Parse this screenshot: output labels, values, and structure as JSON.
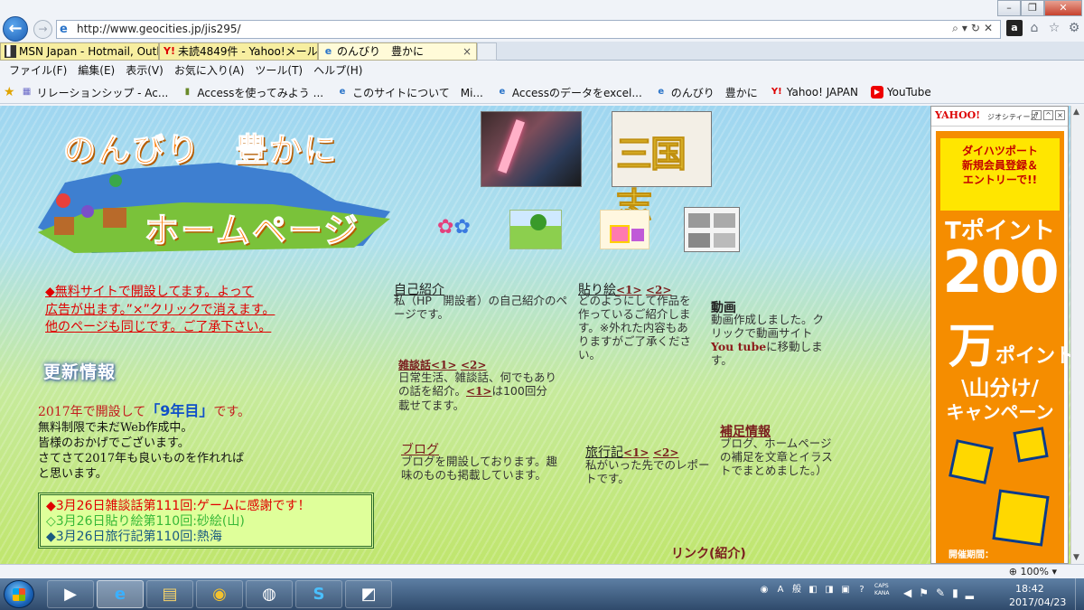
{
  "browser": {
    "url": "http://www.geocities.jp/jis295/",
    "tabs": [
      {
        "label": "MSN Japan - Hotmail, Outl...",
        "icon": "msn-icon"
      },
      {
        "label": "未読4849件 - Yahoo!メール",
        "icon": "yahoo-icon",
        "badge": "Y!"
      },
      {
        "label": "のんびり　豊かに",
        "icon": "ie-page-icon",
        "close": "×"
      }
    ],
    "menu": [
      "ファイル(F)",
      "編集(E)",
      "表示(V)",
      "お気に入り(A)",
      "ツール(T)",
      "ヘルプ(H)"
    ],
    "favorites": [
      {
        "label": "リレーションシップ - Ac...",
        "icon": "grid-icon"
      },
      {
        "label": "Accessを使ってみよう ...",
        "icon": "book-icon"
      },
      {
        "label": "このサイトについて　Mi...",
        "icon": "ie-page-icon"
      },
      {
        "label": "Accessのデータをexcel...",
        "icon": "ie-page-icon"
      },
      {
        "label": "のんびり　豊かに",
        "icon": "ie-page-icon"
      },
      {
        "label": "Yahoo! JAPAN",
        "icon": "yahoo-icon",
        "badge": "Y!"
      },
      {
        "label": "YouTube",
        "icon": "youtube-icon"
      }
    ],
    "zoom": "100%"
  },
  "page": {
    "logo": {
      "line1": "のんびり　豊かに",
      "line2": "ホームページ"
    },
    "photo_text": "三国志",
    "notices": [
      "◆無料サイトで開設してます。よって",
      "広告が出ます。”×”クリックで消えます。",
      "他のページも同じです。ご了承下さい。"
    ],
    "update_title": "更新情報",
    "open": {
      "pre": "2017年で開設して",
      "big": "「9年目」",
      "post": "です。"
    },
    "body_lines": [
      "無料制限で未だWeb作成中。",
      "皆様のおかげでございます。",
      "さてさて2017年も良いものを作れれば",
      "と思います。"
    ],
    "news": [
      "◆3月26日雑談話第111回:ゲームに感謝です！",
      "◇3月26日貼り絵第110回:砂絵(山)",
      "◆3月26日旅行記第110回:熱海"
    ],
    "sections": {
      "jiko": {
        "title": "自己紹介",
        "body": "私（HP　開設者）の自己紹介のページです。"
      },
      "zatsu": {
        "title": "雑談話",
        "l1": "<1>",
        "l2": "<2>",
        "body_pre": "日常生活、雑談話、何でもありの話を紹介。",
        "inline": "<1>",
        "body_post": "は100回分載せてます。"
      },
      "blog": {
        "title": "ブログ",
        "body": "ブログを開設しております。趣味のものも掲載しています。"
      },
      "hari": {
        "title": "貼り絵",
        "l1": "<1>",
        "l2": "<2>",
        "body": "どのようにして作品を作っているご紹介します。※外れた内容もありますがご了承ください。"
      },
      "ryoko": {
        "title": "旅行記",
        "l1": "<1>",
        "l2": "<2>",
        "body": "私がいった先でのレポートです。"
      },
      "douga": {
        "title": "動画",
        "body_pre": "動画作成しました。クリックで動画サイト",
        "link": "You tube",
        "body_post": "に移動します。"
      },
      "hosoku": {
        "title": "補足情報",
        "body": "ブログ、ホームページの補足を文章とイラストでまとめました。）"
      },
      "link": {
        "title": "リンク(紹介)"
      }
    }
  },
  "ad": {
    "yahoo": "YAHOO!",
    "geo": "ジオシティーズ",
    "ctrls": [
      "?",
      "^",
      "×"
    ],
    "yellow": [
      "ダイハツポート",
      "新規会員登録＆",
      "エントリーで!!"
    ],
    "t1": "Tポイント",
    "t2": "200",
    "t3_big": "万",
    "t3_small": "ポイント",
    "t4": "\\山分け/",
    "t5": "キャンペーン",
    "period": "開催期間："
  },
  "taskbar": {
    "apps": [
      "media-player-icon",
      "internet-explorer-icon",
      "file-explorer-icon",
      "chrome-icon",
      "network-app-icon",
      "skype-icon",
      "notes-icon"
    ],
    "caps": "CAPS",
    "kana": "KANA",
    "time": "18:42",
    "date": "2017/04/23"
  },
  "colors": {
    "accent": "#1d5fb4",
    "notice": "#e00000",
    "ad_orange": "#f58d00"
  }
}
